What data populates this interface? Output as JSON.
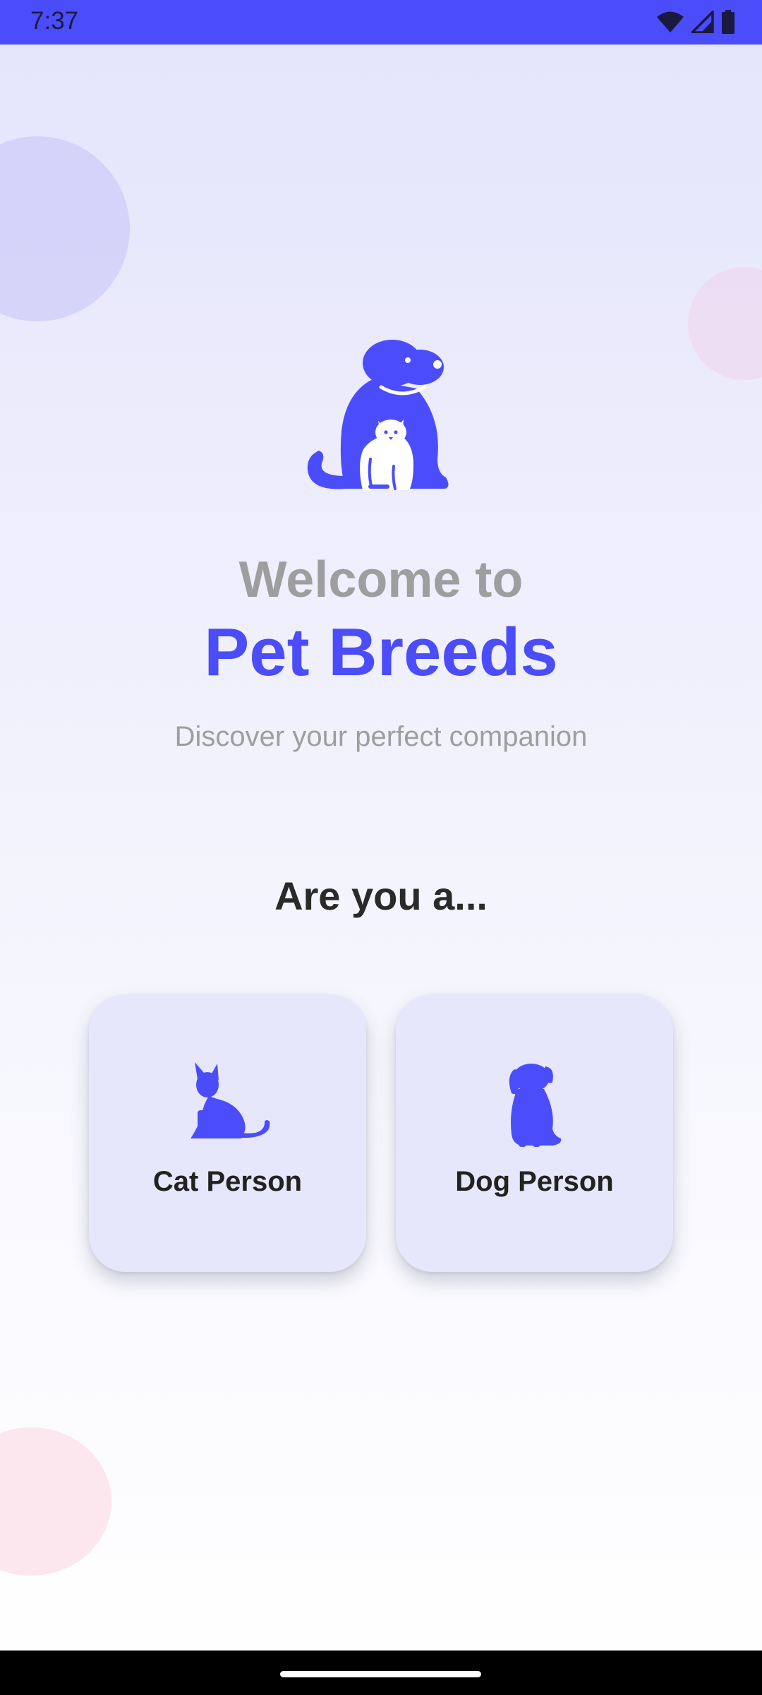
{
  "status_bar": {
    "time": "7:37",
    "icons": [
      "wifi-icon",
      "signal-icon",
      "battery-icon"
    ]
  },
  "hero": {
    "logo_icon": "dog-and-cat-icon",
    "welcome": "Welcome to",
    "app_title": "Pet Breeds",
    "tagline": "Discover your perfect companion"
  },
  "question": "Are you a...",
  "choices": [
    {
      "label": "Cat Person",
      "icon": "cat-icon"
    },
    {
      "label": "Dog Person",
      "icon": "dog-icon"
    }
  ],
  "colors": {
    "accent": "#4b4cfa",
    "card_bg": "#e7e7fb",
    "muted_text": "#9e9e9e",
    "heading_text": "#2a2a2a"
  }
}
